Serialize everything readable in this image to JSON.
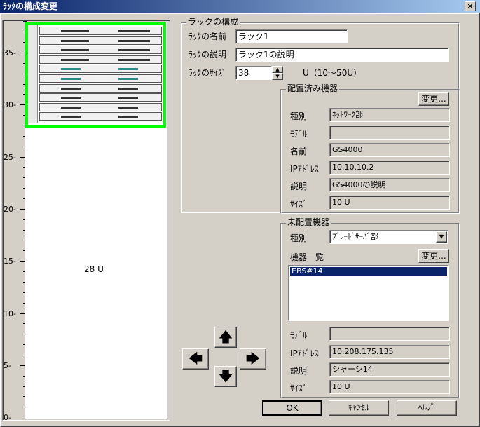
{
  "window": {
    "title": "ﾗｯｸの構成変更",
    "close_glyph": "×"
  },
  "ruler": {
    "labels": [
      "35",
      "30",
      "25",
      "20",
      "15",
      "10",
      "5",
      "0"
    ]
  },
  "rack": {
    "free_units_label": "28 U"
  },
  "rack_config": {
    "title": "ラックの構成",
    "name_label": "ﾗｯｸの名前",
    "name_value": "ラック1",
    "desc_label": "ﾗｯｸの説明",
    "desc_value": "ラック1の説明",
    "size_label": "ﾗｯｸのｻｲｽﾞ",
    "size_value": "38",
    "size_range": "U（10～50U）"
  },
  "placed": {
    "title": "配置済み機器",
    "change_button": "変更...",
    "type_label": "種別",
    "type_value": "ﾈｯﾄﾜｰｸ部",
    "model_label": "ﾓﾃﾞﾙ",
    "model_value": "",
    "name_label": "名前",
    "name_value": "GS4000",
    "ip_label": "IPｱﾄﾞﾚｽ",
    "ip_value": "10.10.10.2",
    "desc_label": "説明",
    "desc_value": "GS4000の説明",
    "size_label": "ｻｲｽﾞ",
    "size_value": "10 U"
  },
  "unplaced": {
    "title": "未配置機器",
    "type_label": "種別",
    "type_value": "ﾌﾞﾚｰﾄﾞｻｰﾊﾞ部",
    "list_label": "機器一覧",
    "change_button": "変更...",
    "list_items": [
      "EBS#14"
    ],
    "model_label": "ﾓﾃﾞﾙ",
    "model_value": "",
    "ip_label": "IPｱﾄﾞﾚｽ",
    "ip_value": "10.208.175.135",
    "desc_label": "説明",
    "desc_value": "シャーシ14",
    "size_label": "ｻｲｽﾞ",
    "size_value": "10 U"
  },
  "arrows": {
    "up": "🡅",
    "down": "🡇",
    "left": "🡄",
    "right": "🡆"
  },
  "footer": {
    "ok": "OK",
    "cancel": "ｷｬﾝｾﾙ",
    "help": "ﾍﾙﾌﾟ"
  }
}
